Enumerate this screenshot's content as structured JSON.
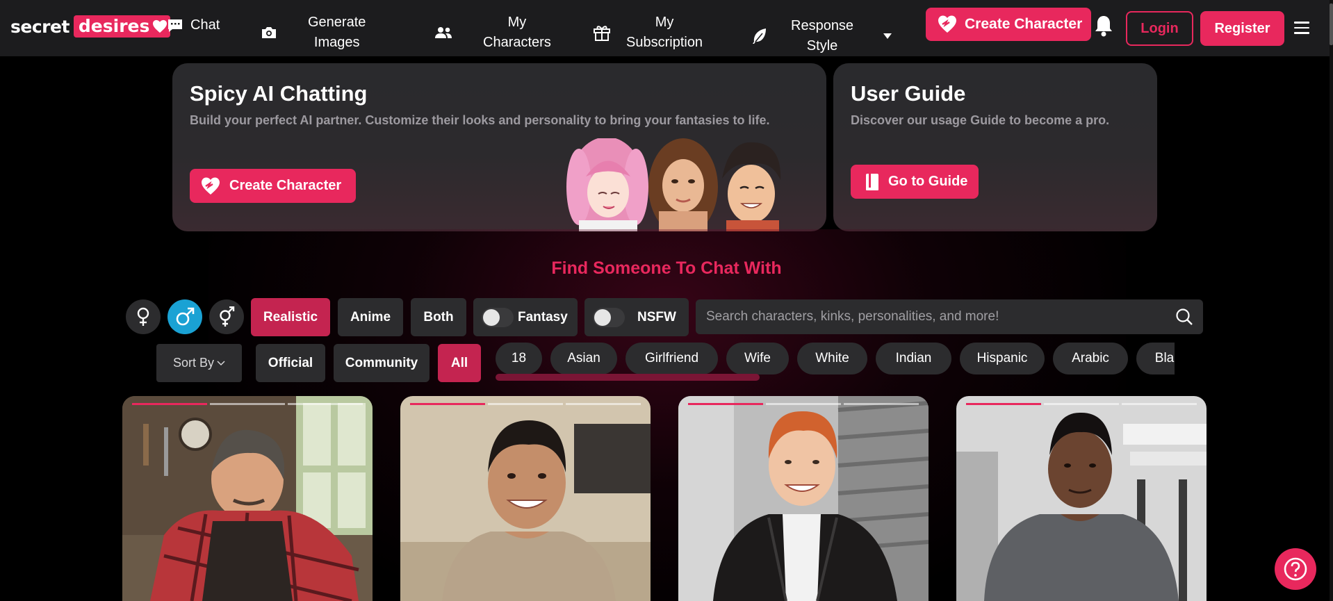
{
  "brand": {
    "secret": "secret",
    "desires": "desires",
    "accent": "#e8285d"
  },
  "nav": {
    "chat": "Chat",
    "generate_images": [
      "Generate",
      "Images"
    ],
    "my_characters": [
      "My",
      "Characters"
    ],
    "my_subscription": [
      "My",
      "Subscription"
    ],
    "response_style": [
      "Response",
      "Style"
    ],
    "create_character": "Create Character",
    "login": "Login",
    "register": "Register"
  },
  "hero": {
    "spicy": {
      "title": "Spicy AI Chatting",
      "subtitle": "Build your perfect AI partner. Customize their looks and personality to bring your fantasies to life.",
      "button": "Create Character"
    },
    "guide": {
      "title": "User Guide",
      "subtitle": "Discover our usage Guide to become a pro.",
      "button": "Go to Guide"
    }
  },
  "find_title": "Find Someone To Chat With",
  "filters": {
    "gender_selected": "male",
    "style": [
      "Realistic",
      "Anime",
      "Both"
    ],
    "style_selected": "Realistic",
    "fantasy": {
      "label": "Fantasy",
      "on": false
    },
    "nsfw": {
      "label": "NSFW",
      "on": false
    },
    "search_placeholder": "Search characters, kinks, personalities, and more!",
    "sort_by": "Sort By",
    "source": [
      "Official",
      "Community",
      "All"
    ],
    "source_selected": "All",
    "tags": [
      "18",
      "Asian",
      "Girlfriend",
      "Wife",
      "White",
      "Indian",
      "Hispanic",
      "Arabic",
      "Black"
    ]
  },
  "cards": [
    {
      "name": "card-1",
      "image": "man-in-apron-workshop"
    },
    {
      "name": "card-2",
      "image": "smiling-man-beige-shirt"
    },
    {
      "name": "card-3",
      "image": "redhead-man-leather-jacket"
    },
    {
      "name": "card-4",
      "image": "man-gym-gray-shirt"
    }
  ]
}
